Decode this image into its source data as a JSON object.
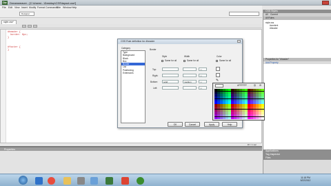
{
  "window": {
    "title": "Dreamweaver - [C:\\Users\\...\\Desktop\\CSS\\layout.css*]",
    "app": "Dw"
  },
  "menu": [
    "File",
    "Edit",
    "View",
    "Insert",
    "Modify",
    "Format",
    "Commands",
    "Site",
    "Window",
    "Help"
  ],
  "toolbar": {
    "workspace": "Designer",
    "search_placeholder": ""
  },
  "document": {
    "tab": "style.css*",
    "code_lines": [
      "#header {",
      "  border: 6px;",
      "}",
      "",
      "#footer {",
      "}"
    ]
  },
  "panels": {
    "css_styles": "CSS Styles",
    "all_rules": "All Rules",
    "tab_all": "All",
    "tab_current": "Current",
    "rules": [
      "style.css",
      "#content",
      "#header"
    ],
    "properties": "Properties for \"#header\"",
    "add_property": "Add Property",
    "properties_panel": "Properties",
    "applications": "Applications",
    "tag_inspector": "Tag Inspector",
    "files": "Files"
  },
  "dialog": {
    "title": "CSS Rule definition for #header",
    "category_label": "Category",
    "categories": [
      "Type",
      "Background",
      "Block",
      "Box",
      "Border",
      "List",
      "Positioning",
      "Extensions"
    ],
    "selected": "Border",
    "section": "Border",
    "col_style": "Style",
    "col_width": "Width",
    "col_color": "Color",
    "same_for_all": "Same for all",
    "rows": [
      {
        "label": "Top:",
        "style": "",
        "width": "",
        "unit": "px"
      },
      {
        "label": "Right:",
        "style": "",
        "width": "",
        "unit": "px"
      },
      {
        "label": "Bottom:",
        "style": "solid",
        "width": "medium",
        "unit": "px"
      },
      {
        "label": "Left:",
        "style": "",
        "width": "",
        "unit": "px"
      }
    ],
    "buttons": {
      "ok": "OK",
      "cancel": "Cancel",
      "apply": "Apply",
      "help": "Help"
    }
  },
  "color_picker": {
    "hex": "#FFFFFF"
  },
  "statusbar": {
    "text": "1K / 1 sec"
  },
  "clock": {
    "time": "11:18 PM",
    "date": "5/22/2012"
  },
  "colors": {
    "selection": "#3367d6"
  }
}
